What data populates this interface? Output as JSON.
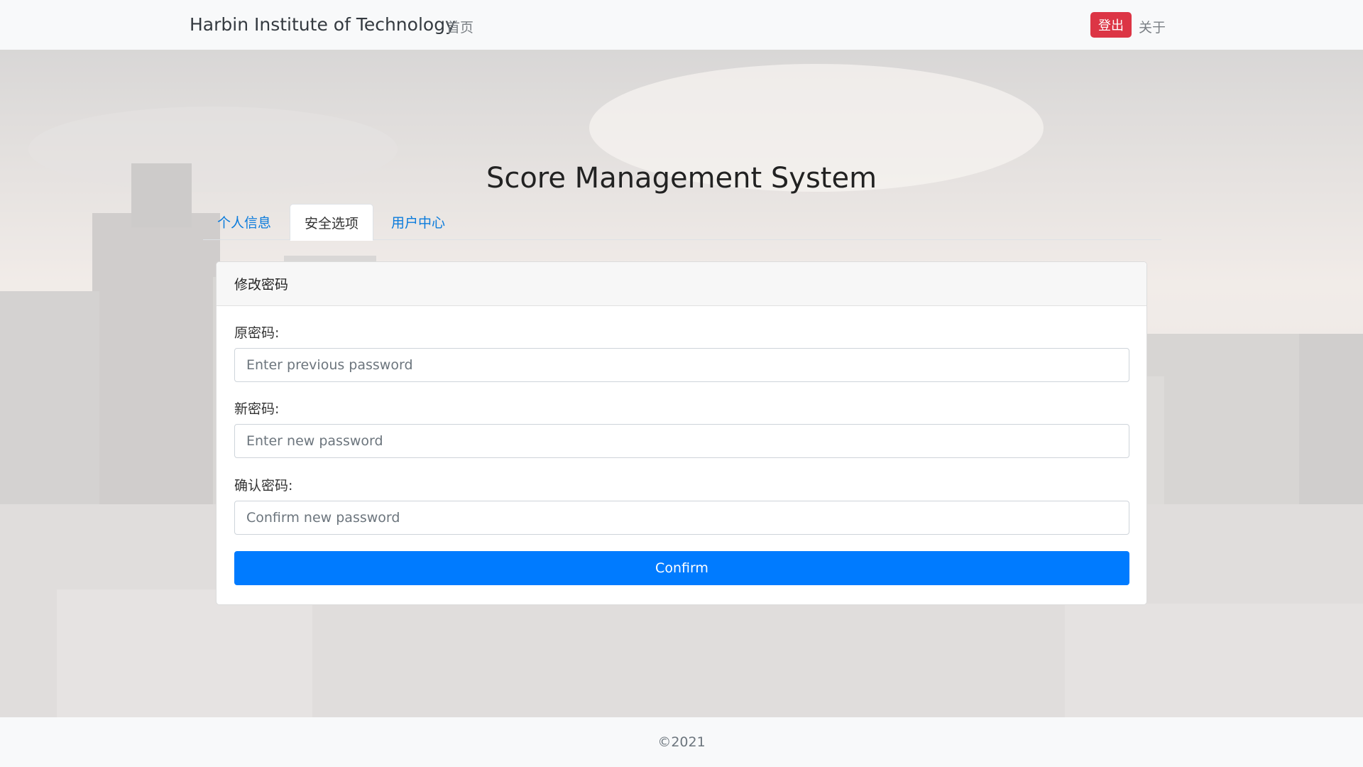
{
  "navbar": {
    "brand": "Harbin Institute of Technology",
    "home": "首页",
    "logout": "登出",
    "about": "关于"
  },
  "page_title": "Score Management System",
  "tabs": [
    {
      "label": "个人信息",
      "active": false
    },
    {
      "label": "安全选项",
      "active": true
    },
    {
      "label": "用户中心",
      "active": false
    }
  ],
  "card": {
    "header": "修改密码",
    "fields": [
      {
        "label": "原密码:",
        "placeholder": "Enter previous password",
        "value": ""
      },
      {
        "label": "新密码:",
        "placeholder": "Enter new password",
        "value": ""
      },
      {
        "label": "确认密码:",
        "placeholder": "Confirm new password",
        "value": ""
      }
    ],
    "confirm_label": "Confirm"
  },
  "footer": "©2021",
  "colors": {
    "logout": "#dc3545",
    "primary": "#007bff",
    "tab_link": "#0a7bdc",
    "navbar_bg": "#f8f9fa"
  }
}
